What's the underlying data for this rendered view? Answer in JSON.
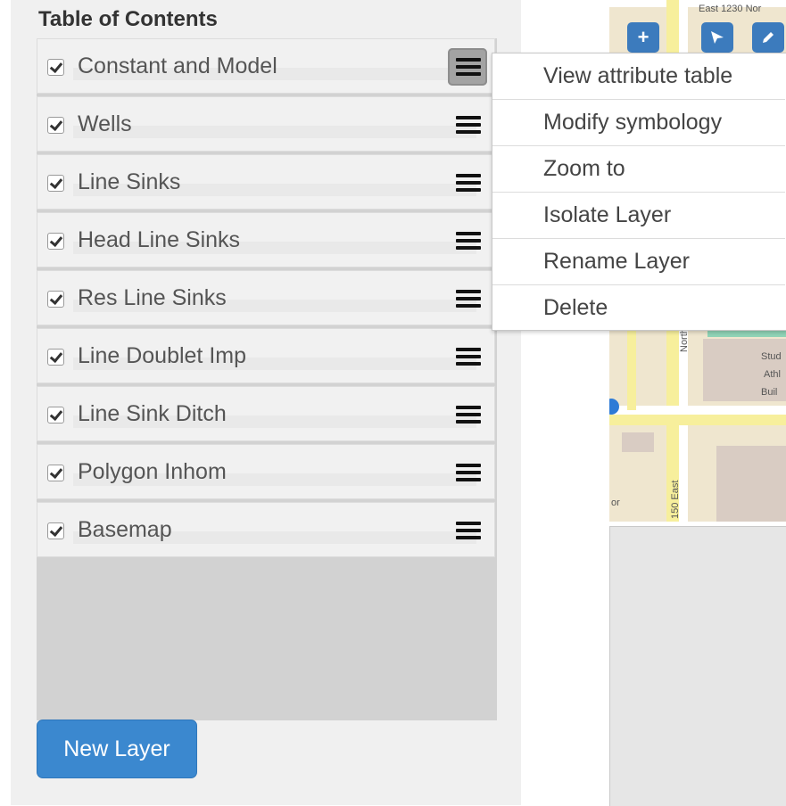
{
  "toc": {
    "title": "Table of Contents",
    "layers": [
      {
        "label": "Constant and Model",
        "checked": true,
        "menu_active": true
      },
      {
        "label": "Wells",
        "checked": true
      },
      {
        "label": "Line Sinks",
        "checked": true
      },
      {
        "label": "Head Line Sinks",
        "checked": true
      },
      {
        "label": "Res Line Sinks",
        "checked": true
      },
      {
        "label": "Line Doublet Imp",
        "checked": true
      },
      {
        "label": "Line Sink Ditch",
        "checked": true
      },
      {
        "label": "Polygon Inhom",
        "checked": true
      },
      {
        "label": "Basemap",
        "checked": true
      }
    ],
    "new_layer_label": "New Layer"
  },
  "context_menu": {
    "items": [
      "View attribute table",
      "Modify symbology",
      "Zoom to",
      "Isolate Layer",
      "Rename Layer",
      "Delete"
    ]
  },
  "map": {
    "street_top": "East 1230 Nor",
    "street_north": "North Can",
    "street_east": "150 East",
    "bldg_text_1": "Stud",
    "bldg_text_2": "Athl",
    "bldg_text_3": "Buil",
    "corner_text": "or",
    "tools": [
      "zoom-in-tool",
      "select-tool",
      "edit-tool"
    ]
  },
  "colors": {
    "accent": "#3b88cf",
    "panel_bg": "#f0f0f0",
    "list_bg": "#d2d2d2",
    "map_tool": "#3c7bbd"
  }
}
